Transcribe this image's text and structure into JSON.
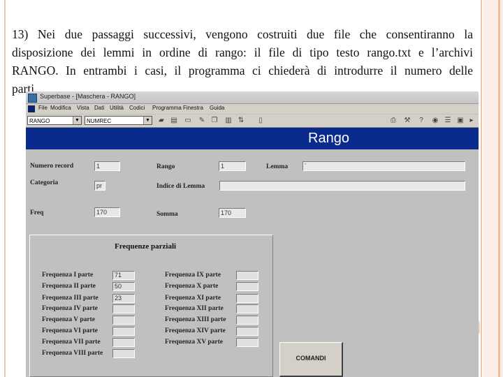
{
  "slide": {
    "line1": "13) Nei due passaggi successivi, vengono costruiti due file che consentiranno la",
    "line2": "disposizione dei lemmi in ordine di rango: il file di tipo testo rango.txt e l’archivi",
    "line3": "RANGO. In entrambi i casi, il programma ci chiederà di introdurre il numero delle",
    "line4": "parti."
  },
  "window": {
    "title": "Superbase - [Maschera - RANGO]",
    "menu": [
      "File",
      "Modifica",
      "Vista",
      "Dati",
      "Utilità",
      "Codici",
      "Programma",
      "Finestra",
      "Guida"
    ]
  },
  "toolbar": {
    "combo1_value": "RANGO",
    "combo2_value": "NUMREC",
    "combo_arrow": "▼",
    "icons": [
      "save-icon",
      "print-icon",
      "open-icon",
      "edit-icon",
      "copy-icon",
      "filter-icon",
      "sort-icon",
      "find-icon",
      "printer-icon",
      "tools-icon",
      "help-icon",
      "record-icon",
      "list-icon",
      "window-icon",
      "nav-icon"
    ]
  },
  "form": {
    "title": "Rango",
    "labels": {
      "numero_record": "Numero record",
      "rango": "Rango",
      "lemma": "Lemma",
      "categoria": "Categoria",
      "indice_lemma": "Indice di Lemma",
      "freq": "Freq",
      "somma": "Somma"
    },
    "values": {
      "numero_record": "1",
      "rango": "1",
      "lemma": "`",
      "categoria": "pr",
      "indice_lemma": "",
      "freq": "170",
      "somma": "170"
    }
  },
  "frequenze": {
    "title": "Frequenze parziali",
    "left": [
      {
        "label": "Frequenza I parte",
        "value": "71"
      },
      {
        "label": "Frequenza II parte",
        "value": "50"
      },
      {
        "label": "Frequenza III parte",
        "value": "23"
      },
      {
        "label": "Frequenza IV parte",
        "value": ""
      },
      {
        "label": "Frequenza V parte",
        "value": ""
      },
      {
        "label": "Frequenza VI parte",
        "value": ""
      },
      {
        "label": "Frequenza VII parte",
        "value": ""
      },
      {
        "label": "Frequenza VIII parte",
        "value": ""
      }
    ],
    "right": [
      {
        "label": "Frequenza IX parte",
        "value": ""
      },
      {
        "label": "Frequenza X parte",
        "value": ""
      },
      {
        "label": "Frequenza XI parte",
        "value": ""
      },
      {
        "label": "Frequenza XII parte",
        "value": ""
      },
      {
        "label": "Frequenza XIII parte",
        "value": ""
      },
      {
        "label": "Frequenza XIV parte",
        "value": ""
      },
      {
        "label": "Frequenza XV parte",
        "value": ""
      }
    ]
  },
  "buttons": {
    "comandi": "COMANDI"
  }
}
